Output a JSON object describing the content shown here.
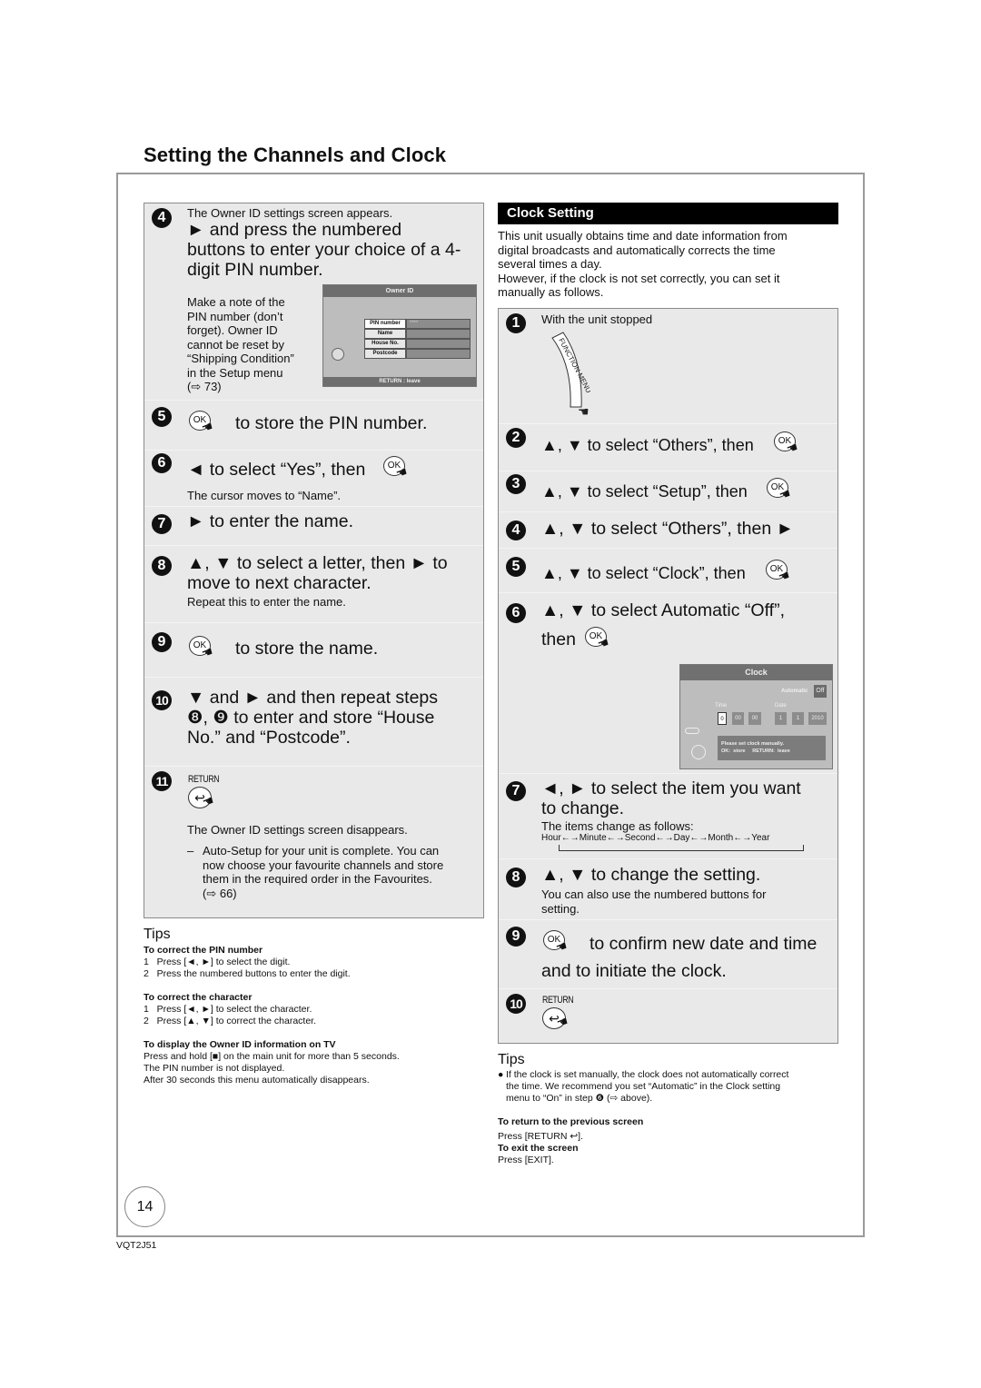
{
  "page": {
    "title": "Setting the Channels and Clock",
    "page_number": "14",
    "doc_code": "VQT2J51"
  },
  "owner_id_steps": {
    "step4": {
      "num": "4",
      "intro": "The Owner ID settings screen appears.",
      "lines": [
        "► and press the numbered",
        "buttons to enter your choice of a 4-",
        "digit PIN number."
      ],
      "note_lines": [
        "Make a note of the",
        "PIN number (don’t",
        "forget). Owner ID",
        "cannot be reset by",
        "“Shipping Condition”",
        "in the Setup menu",
        "(⇨ 73)"
      ]
    },
    "owner_screen": {
      "title": "Owner ID",
      "fields": [
        {
          "label": "PIN number",
          "value": "****"
        },
        {
          "label": "Name",
          "value": ""
        },
        {
          "label": "House No.",
          "value": ""
        },
        {
          "label": "Postcode",
          "value": ""
        }
      ],
      "footer": "RETURN : leave"
    },
    "step5": {
      "num": "5",
      "ok": "OK",
      "text": "to store the PIN number."
    },
    "step6": {
      "num": "6",
      "text": "◄ to select “Yes”, then",
      "ok": "OK",
      "note": "The cursor moves to “Name”."
    },
    "step7": {
      "num": "7",
      "text": "► to enter the name."
    },
    "step8": {
      "num": "8",
      "lines": [
        "▲, ▼ to select a letter, then ► to",
        "move to next character."
      ],
      "note": "Repeat this to enter the name."
    },
    "step9": {
      "num": "9",
      "ok": "OK",
      "text": "to store the name."
    },
    "step10": {
      "num": "10",
      "lines": [
        "▼ and ► and then repeat steps",
        "❽, ❾ to enter and store “House",
        "No.” and “Postcode”."
      ]
    },
    "step11": {
      "num": "11",
      "return_label": "RETURN",
      "text": "The Owner ID settings screen disappears.",
      "dash": "–",
      "bullet_lines": [
        "Auto-Setup for your unit is complete. You can",
        "now choose your favourite channels and store",
        "them in the required order in the Favourites.",
        "(⇨ 66)"
      ]
    }
  },
  "left_tips": {
    "heading": "Tips",
    "sections": [
      {
        "title": "To correct the PIN number",
        "lines": [
          "1   Press [◄, ►] to select the digit.",
          "2   Press the numbered buttons to enter the digit."
        ]
      },
      {
        "title": "To correct the character",
        "lines": [
          "1   Press [◄, ►] to select the character.",
          "2   Press [▲, ▼] to correct the character."
        ]
      },
      {
        "title": "To display the Owner ID information on TV",
        "lines": [
          "Press and hold [■] on the main unit for more than 5 seconds.",
          "The PIN number is not displayed.",
          "After 30 seconds this menu automatically disappears."
        ]
      }
    ]
  },
  "clock_setting": {
    "header": "Clock Setting",
    "intro_lines": [
      "This unit usually obtains time and date information from",
      "digital broadcasts and automatically corrects the time",
      "several times a day.",
      "However, if the clock is not set correctly, you can set it",
      "manually as follows."
    ],
    "step1": {
      "num": "1",
      "text": "With the unit stopped",
      "button": "FUNCTION MENU"
    },
    "step2": {
      "num": "2",
      "text": "▲, ▼ to select “Others”, then",
      "ok": "OK"
    },
    "step3": {
      "num": "3",
      "text": "▲, ▼ to select “Setup”, then",
      "ok": "OK"
    },
    "step4": {
      "num": "4",
      "text": "▲, ▼ to select “Others”, then ►"
    },
    "step5": {
      "num": "5",
      "text": "▲, ▼ to select “Clock”, then",
      "ok": "OK"
    },
    "step6": {
      "num": "6",
      "line1": "▲, ▼ to select Automatic “Off”,",
      "line2": "then",
      "ok": "OK"
    },
    "clock_screen": {
      "title": "Clock",
      "automatic_label": "Automatic",
      "automatic_value": "Off",
      "time_label": "Time",
      "date_label": "Date",
      "hour": "0",
      "minute": "00",
      "second": "00",
      "day": "1",
      "month": "1",
      "year": "2010",
      "msg_line1": "Please set clock manually.",
      "msg_line2": "OK:  store     RETURN:  leave"
    },
    "step7": {
      "num": "7",
      "lines": [
        "◄, ► to select the item you want",
        "to change."
      ],
      "note": "The items change as follows:",
      "cycle": [
        "Hour",
        "Minute",
        "Second",
        "Day",
        "Month",
        "Year"
      ]
    },
    "step8": {
      "num": "8",
      "text": "▲, ▼ to change the setting.",
      "note_lines": [
        "You can also use the numbered buttons for",
        "setting."
      ]
    },
    "step9": {
      "num": "9",
      "ok": "OK",
      "line1": "to confirm new date and time",
      "line2": "and to initiate the clock."
    },
    "step10": {
      "num": "10",
      "return_label": "RETURN"
    }
  },
  "right_tips": {
    "heading": "Tips",
    "bullet_lines": [
      "If the clock is set manually, the clock does not automatically correct",
      "the time. We recommend you set “Automatic” in the Clock setting",
      "menu to “On” in step ❻ (⇨ above)."
    ],
    "sections": [
      {
        "title": "To return to the previous screen",
        "line": "Press [RETURN ↩]."
      },
      {
        "title": "To exit the screen",
        "line": "Press [EXIT]."
      }
    ]
  }
}
